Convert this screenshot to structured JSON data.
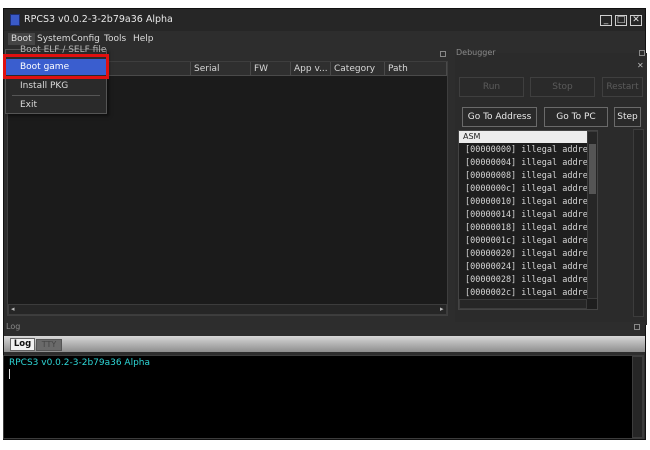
{
  "window": {
    "title": "RPCS3 v0.0.2-3-2b79a36 Alpha",
    "min_glyph": "_",
    "max_glyph": "□",
    "close_glyph": "✕"
  },
  "menubar": {
    "items": [
      {
        "label": "Boot"
      },
      {
        "label": "System"
      },
      {
        "label": "Config"
      },
      {
        "label": "Tools"
      },
      {
        "label": "Help"
      }
    ]
  },
  "boot_menu": {
    "items": [
      {
        "label": "Boot ELF / SELF file"
      },
      {
        "label": "Boot game"
      },
      {
        "label": "Install PKG"
      },
      {
        "label": "Exit"
      }
    ],
    "selected": "Boot game"
  },
  "game_list": {
    "columns": [
      "Serial",
      "FW",
      "App v...",
      "Category",
      "Path"
    ],
    "scroll_left": "◂",
    "scroll_right": "▸"
  },
  "debugger": {
    "title": "Debugger",
    "close_glyph": "✕",
    "run_label": "Run",
    "stop_label": "Stop",
    "restart_label": "Restart",
    "goto_address_label": "Go To Address",
    "goto_pc_label": "Go To PC",
    "step_label": "Step",
    "asm_header": "ASM",
    "asm_lines": [
      "[00000000] illegal addre",
      "[00000004] illegal addre",
      "[00000008] illegal addre",
      "[0000000c] illegal addre",
      "[00000010] illegal addre",
      "[00000014] illegal addre",
      "[00000018] illegal addre",
      "[0000001c] illegal addre",
      "[00000020] illegal addre",
      "[00000024] illegal addre",
      "[00000028] illegal addre",
      "[0000002c] illegal addre"
    ]
  },
  "log": {
    "title": "Log",
    "tabs": [
      {
        "label": "Log"
      },
      {
        "label": "TTY"
      }
    ],
    "active_tab": "Log",
    "text": "RPCS3 v0.0.2-3-2b79a36 Alpha"
  },
  "colors": {
    "accent": "#3a5ecf",
    "highlight": "#e01010",
    "log_text": "#2ed6d6"
  }
}
